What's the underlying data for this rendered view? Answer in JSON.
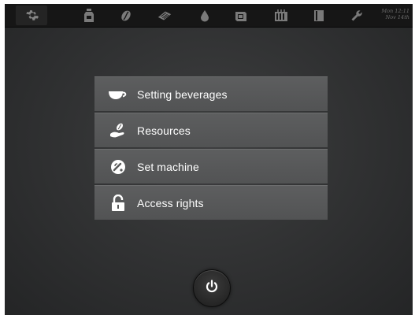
{
  "topbar": {
    "icons": [
      "settings-icon",
      "bottle-icon",
      "coffee-bean-icon",
      "tablet-icon",
      "water-drop-icon",
      "grounds-container-icon",
      "cleaning-icon",
      "door-icon",
      "wrench-icon"
    ],
    "datetime": {
      "line1": "Mon 12:11",
      "line2": "Nov 14th"
    }
  },
  "menu": {
    "items": [
      {
        "label": "Setting beverages",
        "icon": "cup-icon"
      },
      {
        "label": "Resources",
        "icon": "hand-bean-icon"
      },
      {
        "label": "Set machine",
        "icon": "dial-icon"
      },
      {
        "label": "Access rights",
        "icon": "padlock-icon"
      }
    ]
  },
  "power": {
    "icon": "power-icon"
  },
  "colors": {
    "topbar": "#161616",
    "icon_inactive": "#7a7a7a",
    "menu_item": "#585959",
    "menu_text": "#ffffff",
    "background": "#333435"
  }
}
